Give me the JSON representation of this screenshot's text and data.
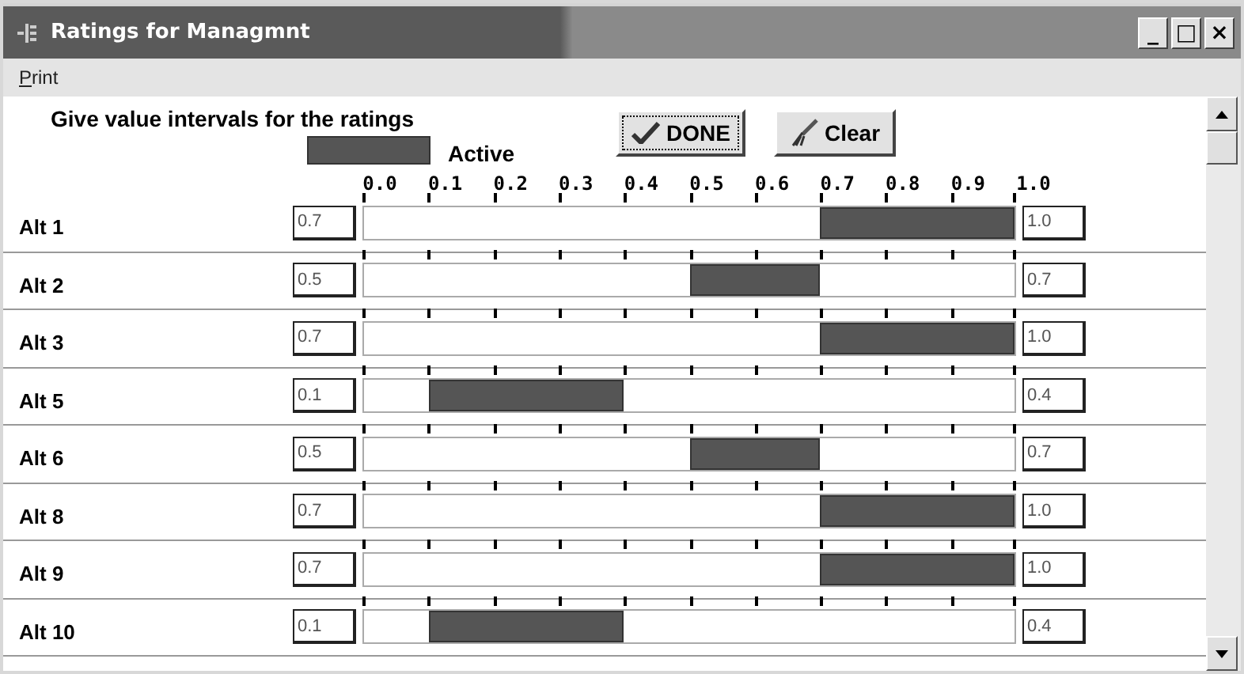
{
  "window": {
    "title": "Ratings for Managmnt",
    "controls": [
      "_",
      "□",
      "×"
    ]
  },
  "menu": [
    {
      "label": "Print"
    }
  ],
  "header": {
    "instruction": "Give value intervals for the ratings",
    "legend": "Active",
    "buttons": [
      {
        "label": "DONE",
        "kind": "done"
      },
      {
        "label": "Clear",
        "kind": "clear"
      }
    ]
  },
  "scale": [
    "0.0",
    "0.1",
    "0.2",
    "0.3",
    "0.4",
    "0.5",
    "0.6",
    "0.7",
    "0.8",
    "0.9",
    "1.0"
  ],
  "rows": [
    {
      "name": "Alt 1",
      "low": "0.7",
      "high": "1.0"
    },
    {
      "name": "Alt 2",
      "low": "0.5",
      "high": "0.7"
    },
    {
      "name": "Alt 3",
      "low": "0.7",
      "high": "1.0"
    },
    {
      "name": "Alt 5",
      "low": "0.1",
      "high": "0.4"
    },
    {
      "name": "Alt 6",
      "low": "0.5",
      "high": "0.7"
    },
    {
      "name": "Alt 8",
      "low": "0.7",
      "high": "1.0"
    },
    {
      "name": "Alt 9",
      "low": "0.7",
      "high": "1.0"
    },
    {
      "name": "Alt 10",
      "low": "0.1",
      "high": "0.4"
    }
  ]
}
